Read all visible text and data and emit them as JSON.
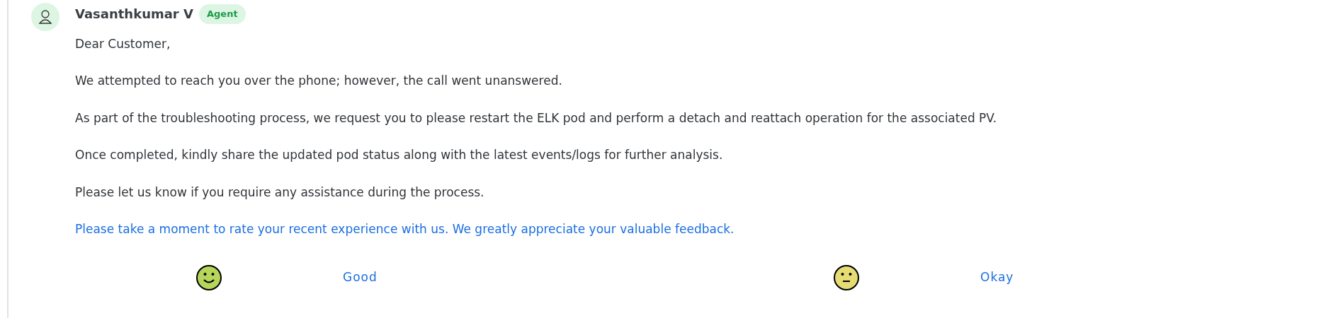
{
  "message": {
    "author": "Vasanthkumar V",
    "role_badge": "Agent",
    "paragraphs": [
      "Dear Customer,",
      "We attempted to reach you over the phone; however, the call went unanswered.",
      "As part of the troubleshooting process, we request you to please restart the ELK pod and perform a detach and reattach operation for the associated PV.",
      "Once completed, kindly share the updated pod status along with the latest events/logs for further analysis.",
      "Please let us know if you require any assistance during the process."
    ],
    "rating_prompt": "Please take a moment to rate your recent experience with us. We greatly appreciate your valuable feedback.",
    "ratings": [
      {
        "kind": "happy",
        "label": "Good"
      },
      {
        "kind": "neutral",
        "label": "Okay"
      }
    ]
  }
}
